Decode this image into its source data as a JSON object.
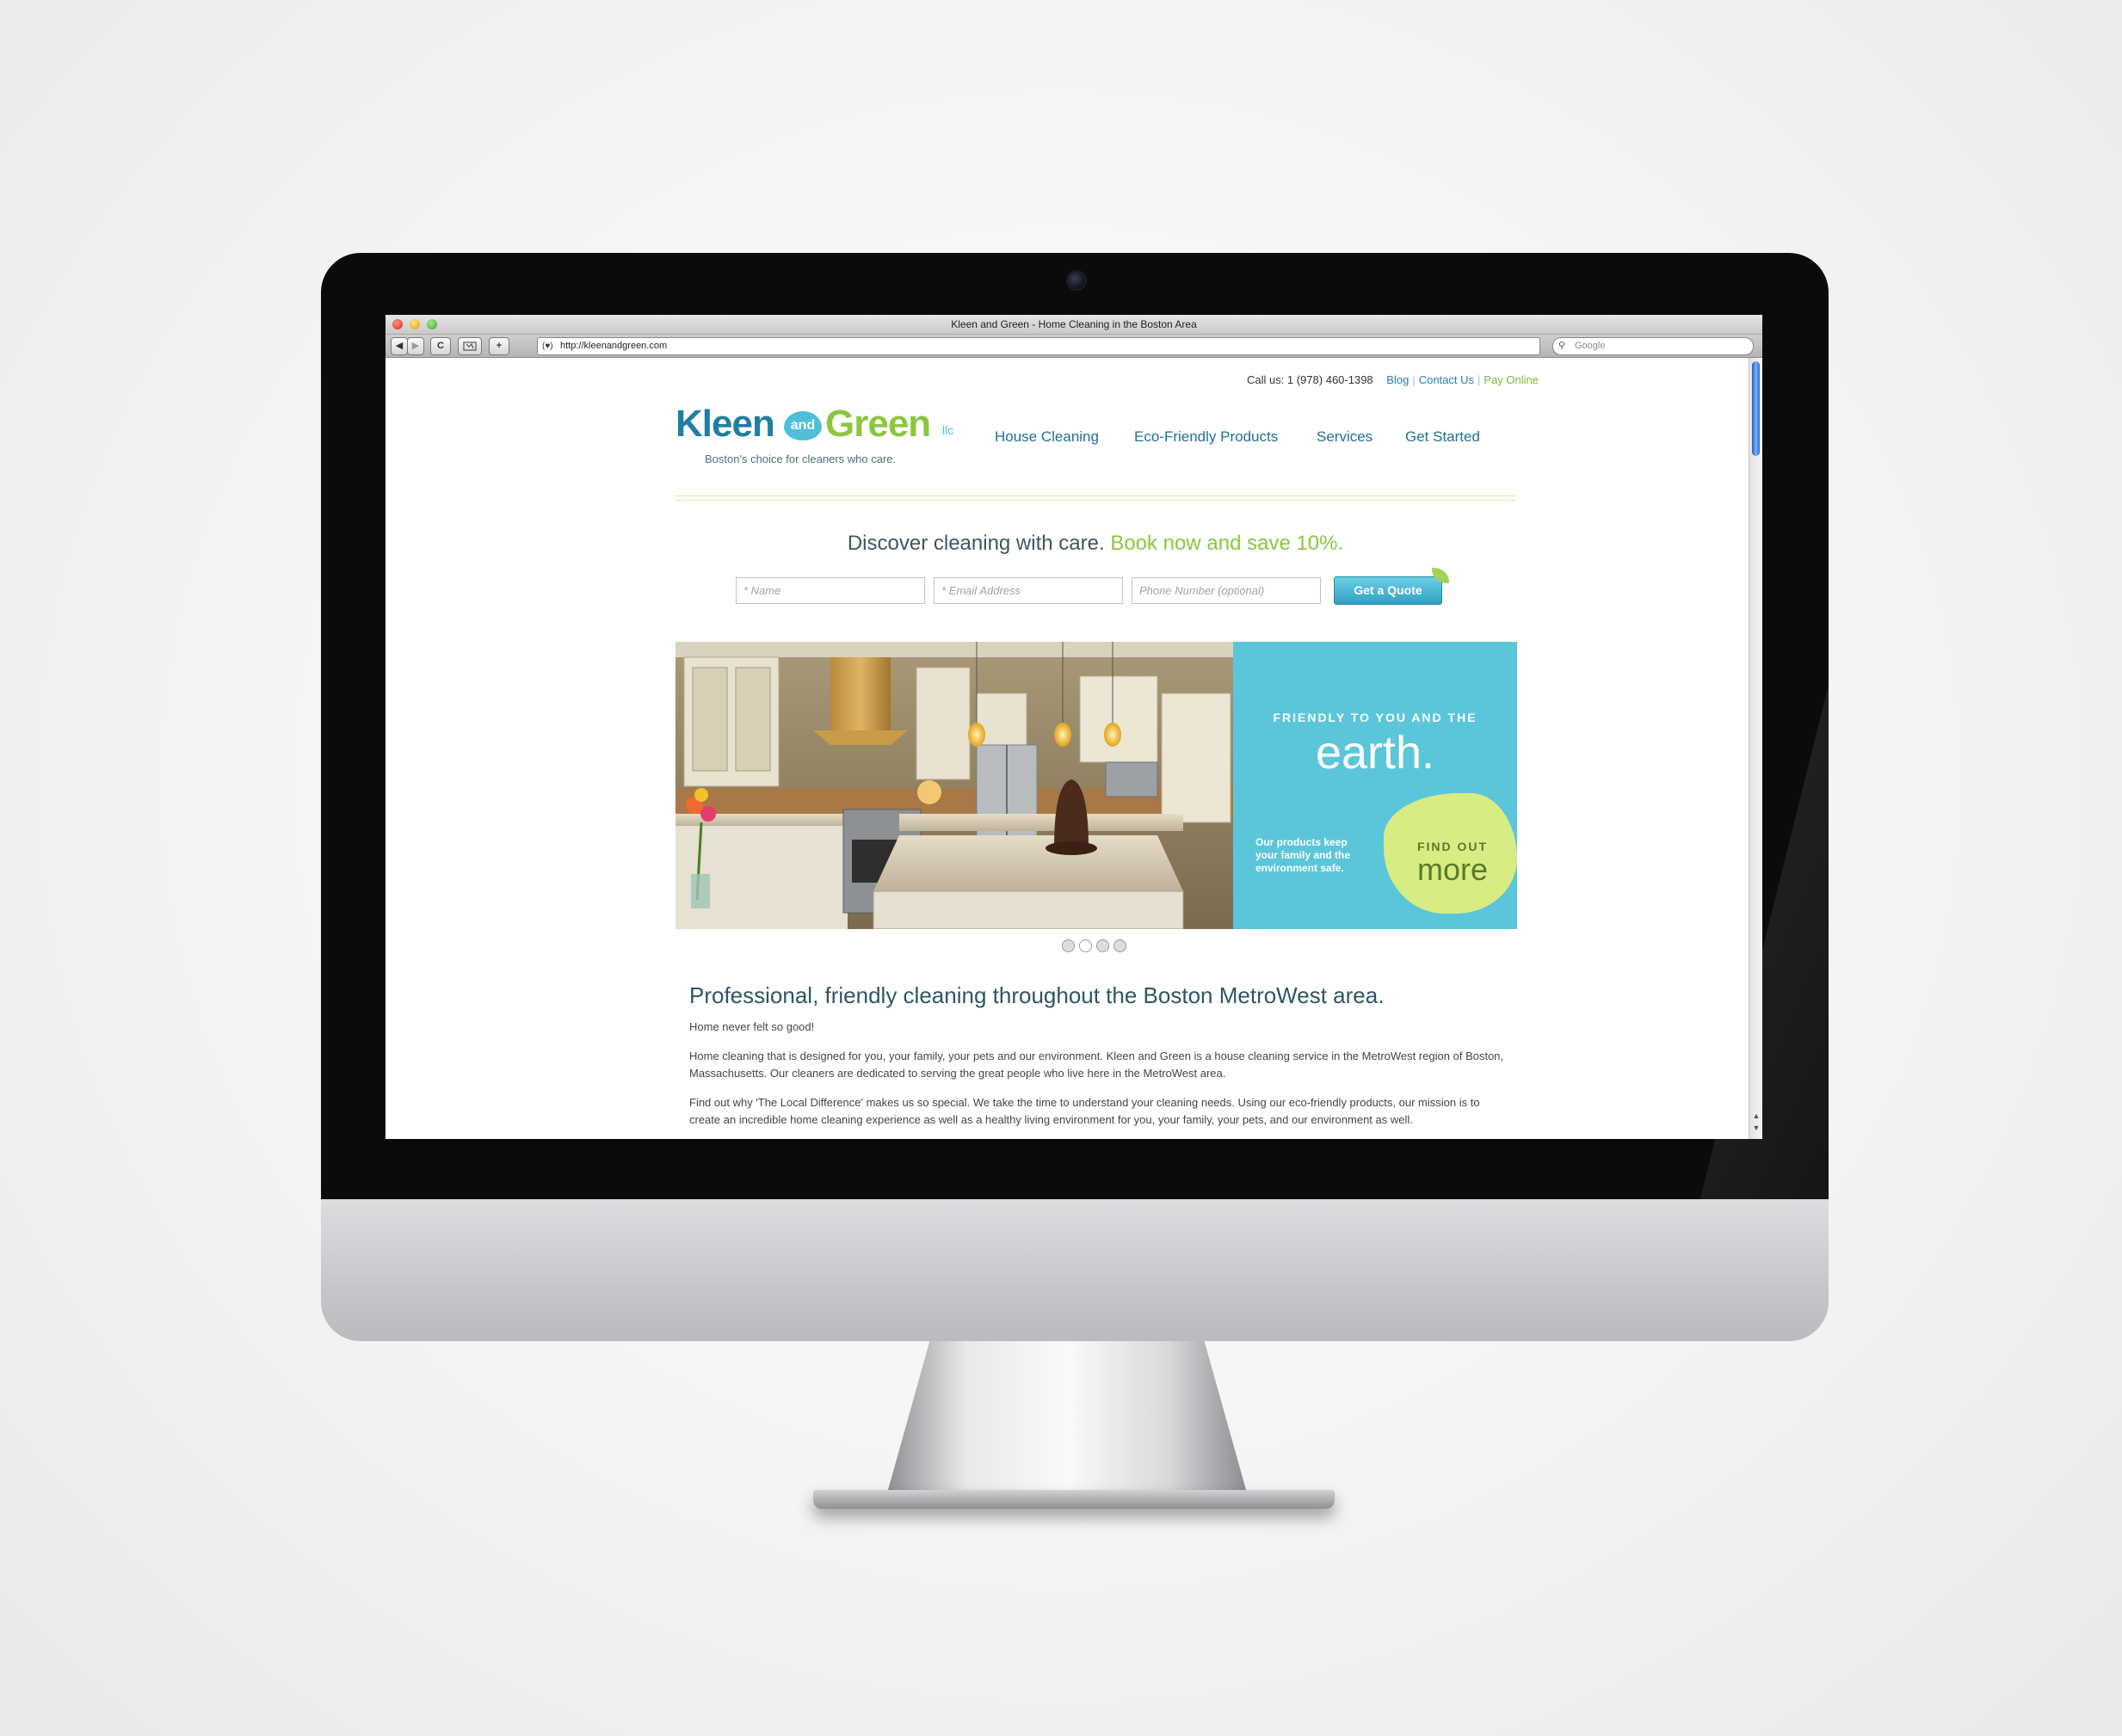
{
  "browser": {
    "window_title": "Kleen and Green - Home Cleaning in the Boston Area",
    "url": "http://kleenandgreen.com",
    "search_placeholder": "Google",
    "nav_back": "◀",
    "nav_forward": "▶",
    "reload": "C",
    "add_bookmark": "+"
  },
  "header": {
    "call_us": "Call us: 1 (978) 460-1398",
    "links": [
      "Blog",
      "Contact Us",
      "Pay Online"
    ],
    "logo": {
      "kleen": "Kleen",
      "and": "and",
      "green": "Green",
      "llc": "llc",
      "tagline": "Boston's choice for cleaners who care."
    },
    "nav": [
      "House Cleaning",
      "Eco-Friendly Products",
      "Services",
      "Get Started"
    ]
  },
  "promo": {
    "headline": "Discover cleaning with care.",
    "headline_green": "Book now and save 10%.",
    "name_placeholder": "* Name",
    "email_placeholder": "* Email Address",
    "phone_placeholder": "Phone Number (optional)",
    "quote_button": "Get a Quote"
  },
  "hero": {
    "kicker": "FRIENDLY TO YOU AND THE",
    "headline": "earth.",
    "body": "Our products keep your family and the environment safe.",
    "cta_small": "FIND OUT",
    "cta_large": "more",
    "slides_count": 4,
    "active_slide": 2
  },
  "content": {
    "heading": "Professional, friendly cleaning throughout the Boston MetroWest area.",
    "paragraphs": [
      "Home never felt so good!",
      "Home cleaning that is designed for you, your family, your pets and our environment. Kleen and Green is a house cleaning service in the MetroWest region of Boston, Massachusetts. Our cleaners are dedicated to serving the great people who live here in the MetroWest area.",
      "Find out why 'The Local Difference' makes us so special. We take the time to understand your cleaning needs. Using our eco-friendly products, our mission is to create an incredible home cleaning experience as well as a healthy living environment for you, your family, your pets, and our environment as well."
    ]
  },
  "colors": {
    "brand_blue": "#1f7fa0",
    "brand_green": "#8cc63e",
    "panel_cyan": "#5bc6da",
    "blob_lime": "#d8ec84"
  }
}
